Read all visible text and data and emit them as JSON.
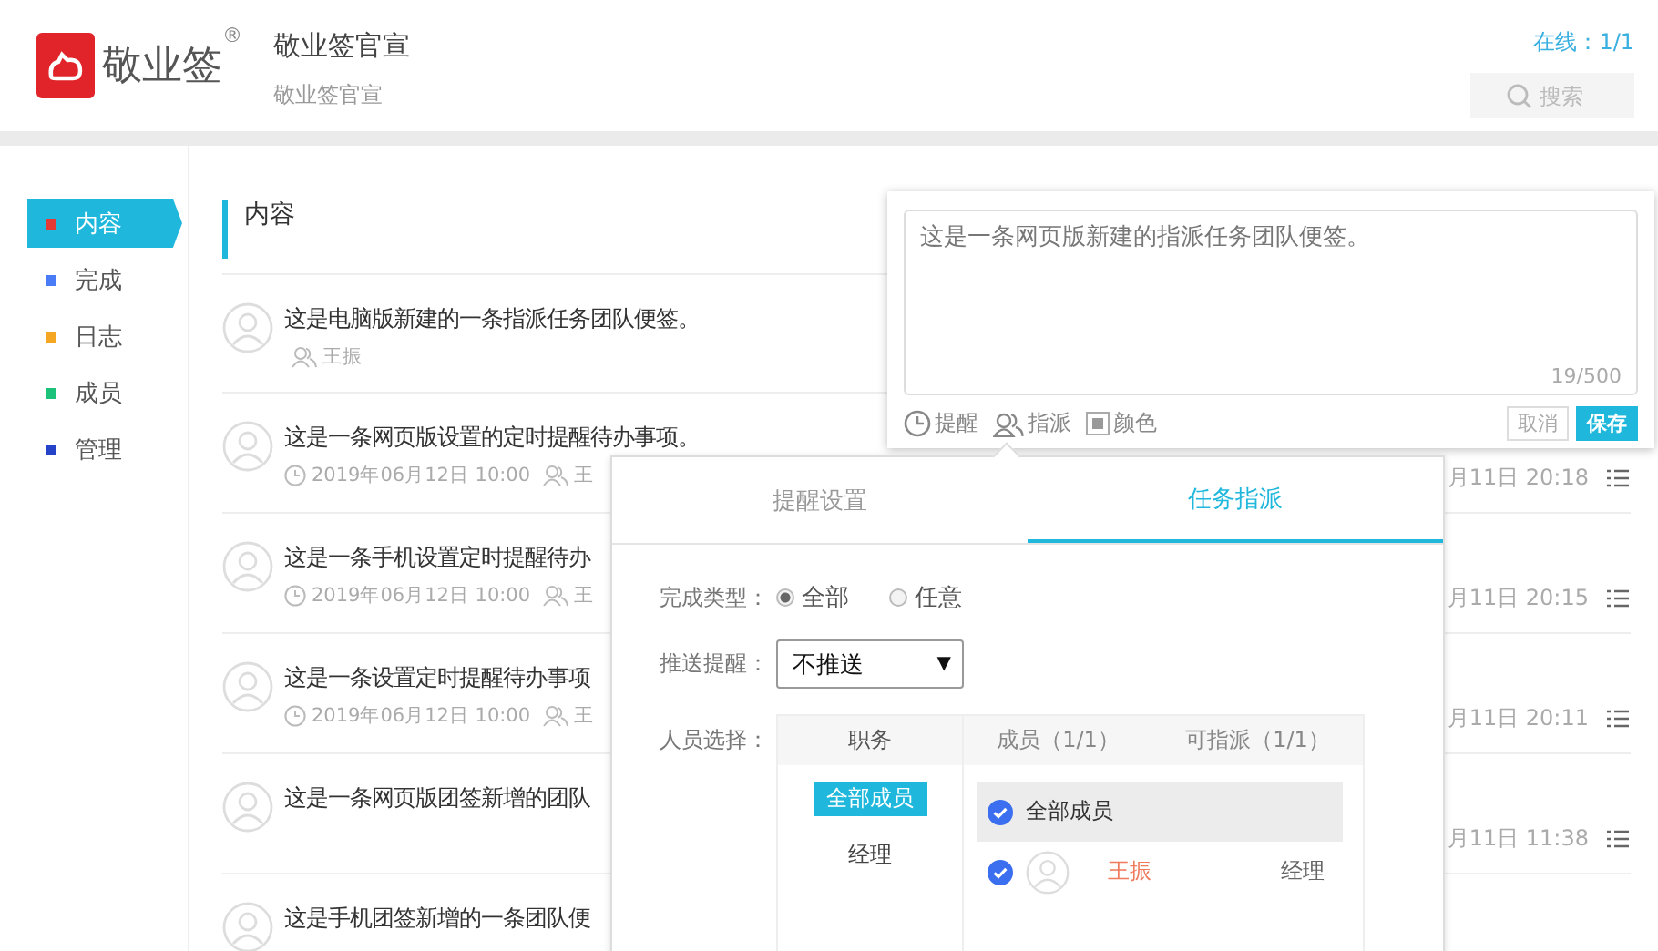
{
  "logo": {
    "name": "敬业签",
    "mark": "®"
  },
  "header": {
    "title": "敬业签官宣",
    "subtitle": "敬业签官宣",
    "online": "在线：1/1",
    "search": {
      "placeholder": "搜索"
    }
  },
  "sidebar": {
    "items": [
      {
        "label": "内容",
        "color": "#e53935",
        "selected": true
      },
      {
        "label": "完成",
        "color": "#4a7bf7",
        "selected": false
      },
      {
        "label": "日志",
        "color": "#f5a623",
        "selected": false
      },
      {
        "label": "成员",
        "color": "#1dc27a",
        "selected": false
      },
      {
        "label": "管理",
        "color": "#2443c8",
        "selected": false
      }
    ]
  },
  "content": {
    "heading": "内容",
    "notes": [
      {
        "title": "这是电脑版新建的一条指派任务团队便签。",
        "assignee": "王振"
      },
      {
        "title": "这是一条网页版设置的定时提醒待办事项。",
        "date": "2019年06月12日 10:00",
        "assignee": "王",
        "time": "月11日 20:18"
      },
      {
        "title": "这是一条手机设置定时提醒待办",
        "date": "2019年06月12日 10:00",
        "assignee": "王",
        "time": "月11日 20:15"
      },
      {
        "title": "这是一条设置定时提醒待办事项",
        "date": "2019年06月12日 10:00",
        "assignee": "王",
        "time": "月11日 20:11"
      },
      {
        "title": "这是一条网页版团签新增的团队",
        "time": "月11日 11:38"
      },
      {
        "title": "这是手机团签新增的一条团队便"
      }
    ]
  },
  "editor": {
    "text": "这是一条网页版新建的指派任务团队便签。",
    "counter": "19/500",
    "tools": [
      {
        "kind": "reminder",
        "label": "提醒"
      },
      {
        "kind": "assign",
        "label": "指派"
      },
      {
        "kind": "color",
        "label": "颜色"
      }
    ],
    "buttons": [
      {
        "label": "取消",
        "primary": false
      },
      {
        "label": "保存",
        "primary": true
      }
    ]
  },
  "assign_panel": {
    "tabs": [
      {
        "label": "提醒设置",
        "selected": false
      },
      {
        "label": "任务指派",
        "selected": true
      }
    ],
    "completion": {
      "label": "完成类型：",
      "options": [
        {
          "label": "全部",
          "selected": true
        },
        {
          "label": "任意",
          "selected": false
        }
      ]
    },
    "push": {
      "label": "推送提醒：",
      "value": "不推送",
      "arrow": "▼"
    },
    "people": {
      "label": "人员选择：",
      "roles_header": "职务",
      "roles": [
        {
          "label": "全部成员",
          "selected": true
        },
        {
          "label": "经理",
          "selected": false
        }
      ],
      "members_header": "成员（1/1）",
      "assignable_header": "可指派（1/1）",
      "members": [
        {
          "kind": "all",
          "name": "全部成员",
          "checked": true
        },
        {
          "kind": "person",
          "name": "王振",
          "role": "经理",
          "checked": true
        }
      ]
    }
  }
}
